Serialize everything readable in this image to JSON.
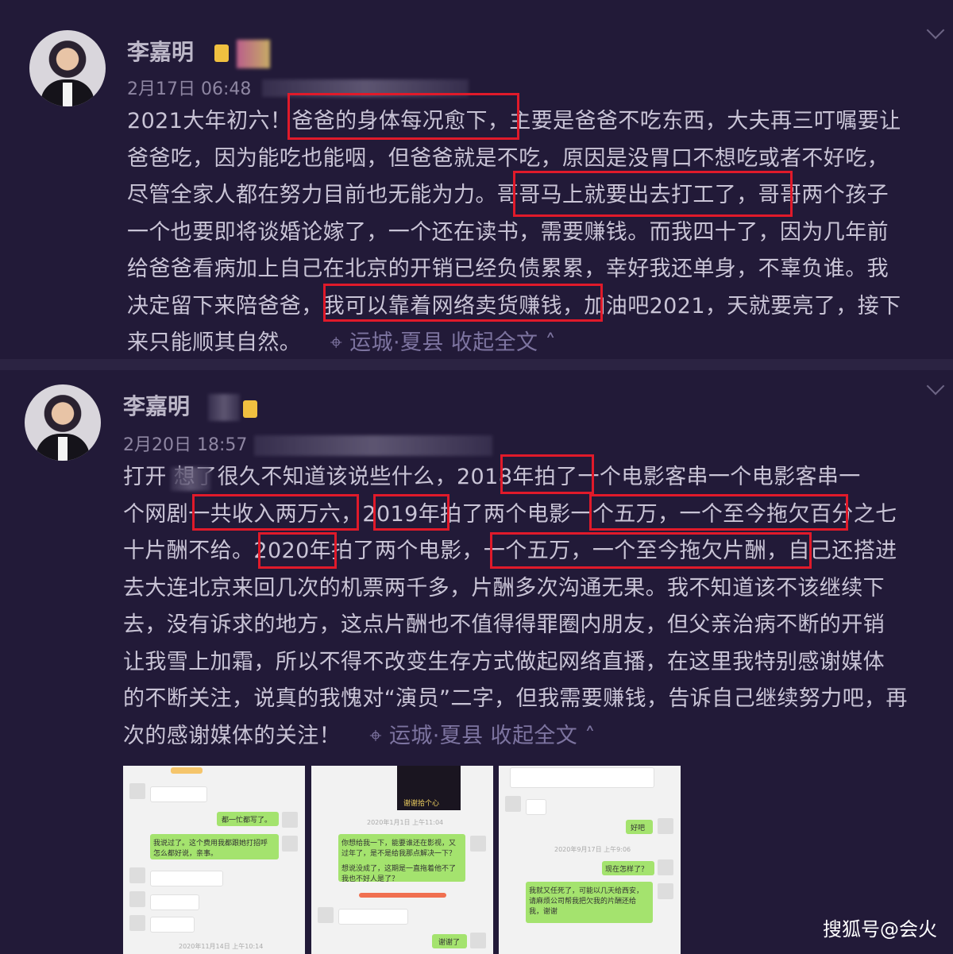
{
  "posts": [
    {
      "author": "李嘉明",
      "time": "2月17日 06:48",
      "lines": [
        "2021大年初六！爸爸的身体每况愈下，主要是爸爸不吃东西，大夫再三叮嘱要让",
        "爸爸吃，因为能吃也能咽，但爸爸就是不吃，原因是没胃口不想吃或者不好吃，",
        "尽管全家人都在努力目前也无能为力。哥哥马上就要出去打工了，哥哥两个孩子",
        "一个也要即将谈婚论嫁了，一个还在读书，需要赚钱。而我四十了，因为几年前",
        "给爸爸看病加上自己在北京的开销已经负债累累，幸好我还单身，不辜负谁。我",
        "决定留下来陪爸爸，我可以靠着网络卖货赚钱，加油吧2021，天就要亮了，接下",
        "来只能顺其自然。"
      ],
      "location": "运城·夏县",
      "collapse": "收起全文"
    },
    {
      "author": "李嘉明",
      "time": "2月20日 18:57",
      "lines": [
        "打开      想了很久不知道该说些什么，2018年拍了一个电影客串一个电影客串一",
        "个网剧一共收入两万六，2019年拍了两个电影一个五万，一个至今拖欠百分之七",
        "十片酬不给。2020年拍了两个电影，一个五万，一个至今拖欠片酬，自己还搭进",
        "去大连北京来回几次的机票两千多，片酬多次沟通无果。我不知道该不该继续下",
        "去，没有诉求的地方，这点片酬也不值得得罪圈内朋友，但父亲治病不断的开销",
        "让我雪上加霜，所以不得不改变生存方式做起网络直播，在这里我特别感谢媒体",
        "的不断关注，说真的我愧对“演员”二字，但我需要赚钱，告诉自己继续努力吧，再",
        "次的感谢媒体的关注！"
      ],
      "location": "运城·夏县",
      "collapse": "收起全文"
    }
  ],
  "screenshots": {
    "s1": {
      "msgs": [
        "都一忙都写了。",
        "我说过了。这个费用我都跟她打招呼怎么都好说，亲事。"
      ],
      "stamp": "2020年11月14日 上午10:14"
    },
    "s2": {
      "msgs": [
        "你想给我一下，能要谁还在影视，又过年了，是不是给我那点解决一下？",
        "想说没成了，这期是一直拖着他不了我也不好人是了？",
        "谢谢了"
      ],
      "poster": "谢谢拾个心",
      "stamp": "2020年1月1日 上午11:04"
    },
    "s3": {
      "msgs": [
        "好吧",
        "现在怎样了？",
        "我就又任死了，可能以几天给西安，请麻烦公司帮我把欠我的片酬还给我，谢谢"
      ],
      "stamp": "2020年9月17日 上午9:06"
    }
  },
  "watermark": "搜狐号@会火",
  "colors": {
    "background": "#221a38",
    "highlight": "#e01a2a",
    "text": "#c9c4d6",
    "location": "#7d74a0"
  }
}
